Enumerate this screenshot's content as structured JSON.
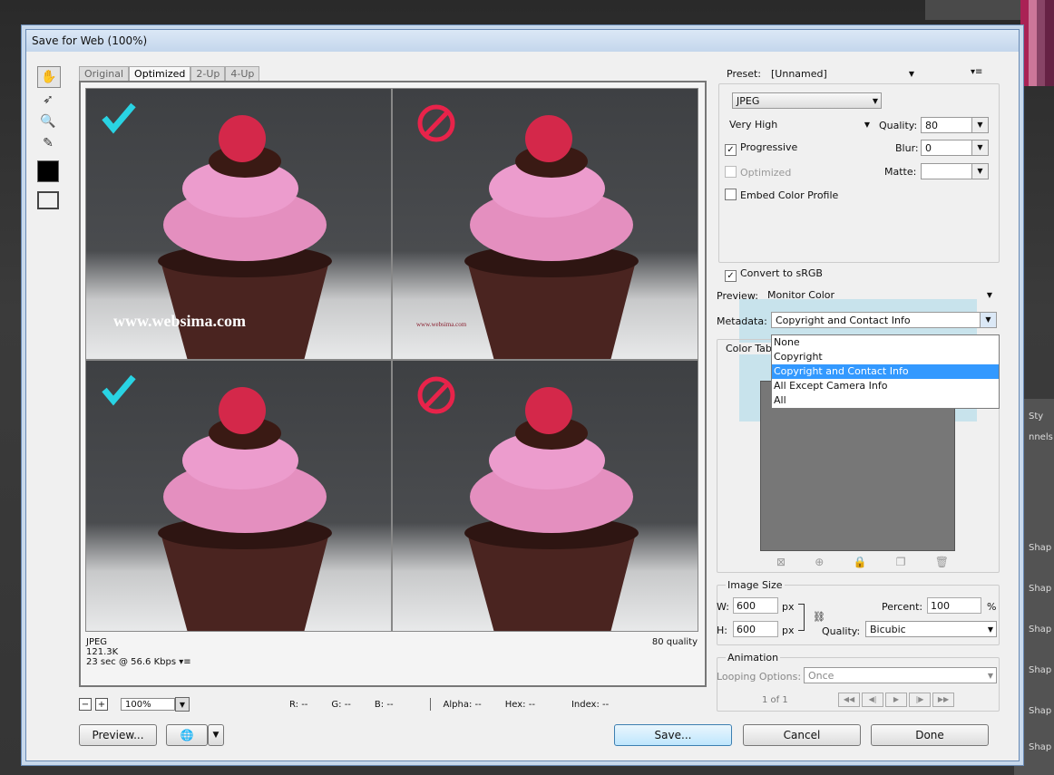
{
  "window_title": "Save for Web (100%)",
  "view_tabs": [
    "Original",
    "Optimized",
    "2-Up",
    "4-Up"
  ],
  "preview": {
    "watermark_left": "www.websima.com",
    "watermark_small": "www.websima.com",
    "format": "JPEG",
    "size": "121.3K",
    "speed": "23 sec @ 56.6 Kbps",
    "quality_note": "80 quality"
  },
  "status": {
    "zoom": "100%",
    "r": "R: --",
    "g": "G: --",
    "b": "B: --",
    "alpha": "Alpha: --",
    "hex": "Hex: --",
    "index": "Index: --"
  },
  "buttons": {
    "preview": "Preview...",
    "save": "Save...",
    "cancel": "Cancel",
    "done": "Done"
  },
  "settings": {
    "preset_label": "Preset:",
    "preset_value": "[Unnamed]",
    "format": "JPEG",
    "quality_preset": "Very High",
    "quality_label": "Quality:",
    "quality_value": "80",
    "progressive": "Progressive",
    "blur_label": "Blur:",
    "blur_value": "0",
    "optimized": "Optimized",
    "matte_label": "Matte:",
    "embed_profile": "Embed Color Profile",
    "convert_srgb": "Convert to sRGB",
    "preview_label": "Preview:",
    "preview_value": "Monitor Color",
    "metadata_label": "Metadata:",
    "metadata_value": "Copyright and Contact Info",
    "color_table": "Color Tab"
  },
  "metadata_options": [
    "None",
    "Copyright",
    "Copyright and Contact Info",
    "All Except Camera Info",
    "All"
  ],
  "image_size": {
    "title": "Image Size",
    "w_label": "W:",
    "w_value": "600",
    "h_label": "H:",
    "h_value": "600",
    "unit": "px",
    "percent_label": "Percent:",
    "percent_value": "100",
    "percent_unit": "%",
    "quality_label": "Quality:",
    "quality_value": "Bicubic"
  },
  "animation": {
    "title": "Animation",
    "looping_label": "Looping Options:",
    "looping_value": "Once",
    "frame_counter": "1 of 1"
  },
  "side_panel": [
    "Sty",
    "nnels",
    "Shap",
    "Shap",
    "Shap",
    "Shap",
    "Shap",
    "Shap"
  ]
}
